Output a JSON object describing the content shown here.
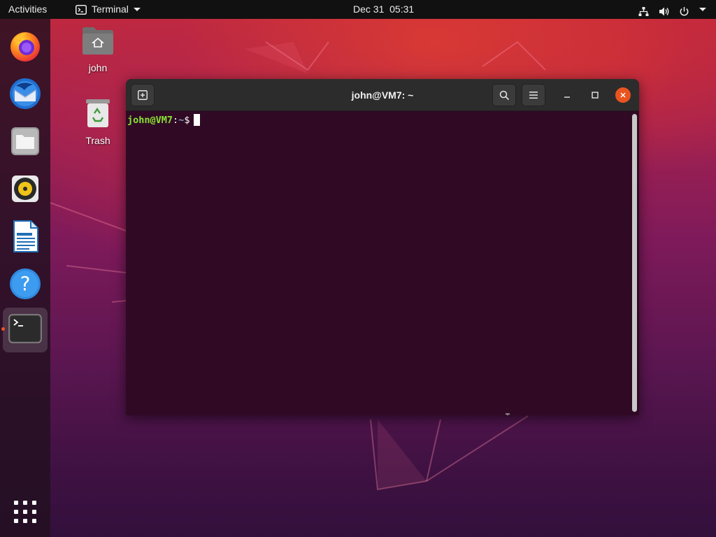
{
  "topbar": {
    "activities_label": "Activities",
    "app_name": "Terminal",
    "clock": "Dec 31  05:31",
    "status_icons": [
      "network-icon",
      "volume-icon",
      "power-icon"
    ]
  },
  "dock": {
    "items": [
      {
        "name": "Firefox Web Browser",
        "icon": "firefox-icon"
      },
      {
        "name": "Thunderbird Mail",
        "icon": "thunderbird-icon"
      },
      {
        "name": "Files",
        "icon": "files-icon"
      },
      {
        "name": "Rhythmbox",
        "icon": "rhythmbox-icon"
      },
      {
        "name": "LibreOffice Writer",
        "icon": "libreoffice-writer-icon"
      },
      {
        "name": "Help",
        "icon": "help-icon"
      },
      {
        "name": "Terminal",
        "icon": "terminal-icon",
        "running": true
      }
    ],
    "show_apps_icon": "app-grid-icon"
  },
  "desktop": {
    "icons": [
      {
        "label": "john",
        "icon": "home-folder-icon"
      },
      {
        "label": "Trash",
        "icon": "trash-icon"
      }
    ]
  },
  "terminal": {
    "title": "john@VM7: ~",
    "prompt": {
      "user_host": "john@VM7",
      "separator": ":",
      "path": "~",
      "symbol": "$"
    },
    "colors": {
      "background": "#300a24",
      "prompt_user": "#8ae234",
      "prompt_path": "#729fcf",
      "close_button": "#e95420"
    }
  }
}
